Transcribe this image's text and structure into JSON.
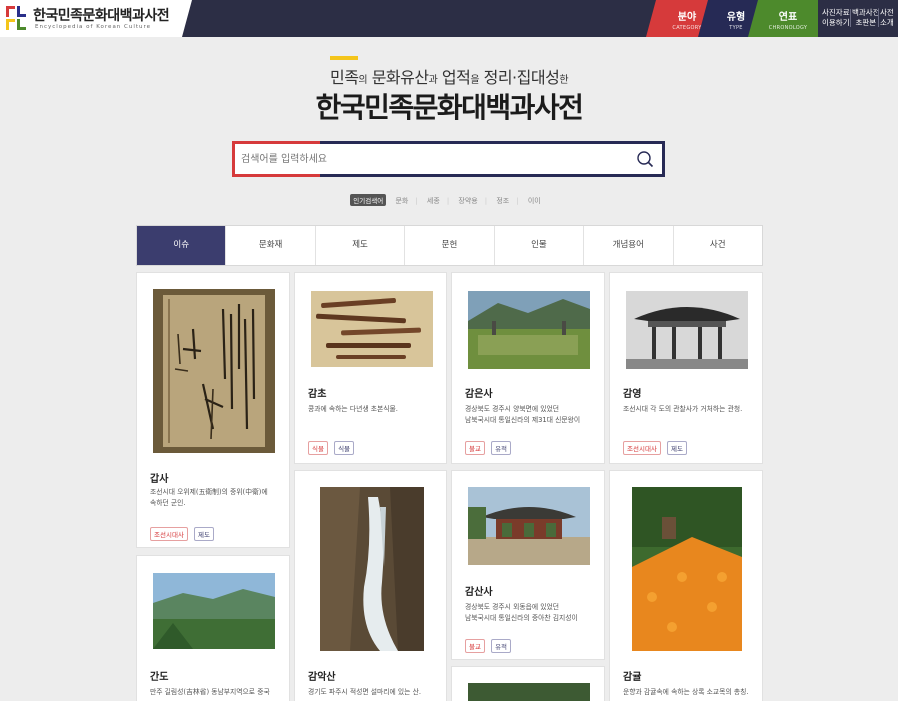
{
  "header": {
    "logo_title": "한국민족문화대백과사전",
    "logo_sub": "Encyclopedia of Korean Culture",
    "nav": [
      {
        "label": "분야",
        "sub": "CATEGORY"
      },
      {
        "label": "유형",
        "sub": "TYPE"
      },
      {
        "label": "연표",
        "sub": "CHRONOLOGY"
      }
    ],
    "util": [
      {
        "line1": "사진자료",
        "line2": "이용하기"
      },
      {
        "line1": "백과사전",
        "line2": "초판본"
      },
      {
        "line1": "사전",
        "line2": "소개"
      }
    ]
  },
  "hero": {
    "sub_a": "민족",
    "sub_b": "의",
    "sub_c": " 문화유산",
    "sub_d": "과",
    "sub_e": " 업적",
    "sub_f": "을",
    "sub_g": " 정리·집대성",
    "sub_h": "한",
    "title": "한국민족문화대백과사전"
  },
  "search": {
    "placeholder": "검색어를 입력하세요"
  },
  "keywords": {
    "popular": "인기검색어",
    "items": [
      "문화",
      "세종",
      "장약용",
      "정조",
      "이이"
    ]
  },
  "tabs": [
    "이슈",
    "문화재",
    "제도",
    "문헌",
    "인물",
    "개념용어",
    "사건"
  ],
  "cards": [
    {
      "title": "갑사",
      "desc1": "조선시대 오위제(五衛制)의 중위(中衛)에",
      "desc2": "속하던 군인.",
      "tags": [
        "조선시대사",
        "제도"
      ]
    },
    {
      "title": "감초",
      "desc1": "콩과에 속하는 다년생 초본식물.",
      "desc2": "",
      "tags": [
        "식물",
        "식물"
      ]
    },
    {
      "title": "감은사",
      "desc1": "경상북도 경주시 양북면에 있었던",
      "desc2": "남북국시대 통일신라의 제31대 신문왕이",
      "tags": [
        "불교",
        "유적"
      ]
    },
    {
      "title": "감영",
      "desc1": "조선시대 각 도의 관찰사가 거처하는 관청.",
      "desc2": "",
      "tags": [
        "조선시대사",
        "제도"
      ]
    },
    {
      "title": "간도",
      "desc1": "만주 길림성(吉林省) 동남부지역으로 중국",
      "desc2": "",
      "tags": []
    },
    {
      "title": "감악산",
      "desc1": "경기도 파주시 적성면 설마리에 있는 산.",
      "desc2": "",
      "tags": []
    },
    {
      "title": "감산사",
      "desc1": "경상북도 경주시 외동읍에 있었던",
      "desc2": "남북국시대 통일신라의 중아찬 김지성이",
      "tags": [
        "불교",
        "유적"
      ]
    },
    {
      "title": "감귤",
      "desc1": "운향과 감귤속에 속하는 상록 소교목의 총칭.",
      "desc2": "",
      "tags": []
    }
  ]
}
